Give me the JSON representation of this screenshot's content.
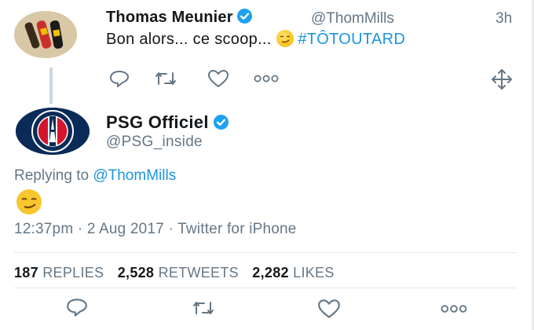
{
  "reply_tweet": {
    "author_name": "Thomas Meunier",
    "handle": "@ThomMills",
    "time": "3h",
    "text": "Bon alors... ce scoop...",
    "hashtag": "#TÔTOUTARD",
    "icons": [
      "reply-icon",
      "retweet-icon",
      "like-icon",
      "more-icon",
      "expand-icon"
    ]
  },
  "main_tweet": {
    "author_name": "PSG Officiel",
    "handle": "@PSG_inside",
    "replying_prefix": "Replying to",
    "replying_handle": "@ThomMills",
    "timestamp": "12:37pm · 2 Aug 2017 · Twitter for iPhone",
    "stats": {
      "replies_count": "187",
      "replies_label": "REPLIES",
      "retweets_count": "2,528",
      "retweets_label": "RETWEETS",
      "likes_count": "2,282",
      "likes_label": "LIKES"
    },
    "icons": [
      "reply-icon",
      "retweet-icon",
      "like-icon",
      "more-icon"
    ]
  },
  "colors": {
    "accent": "#1b95e0",
    "muted": "#657786",
    "verified": "#1da1f2",
    "divider": "#e1e8ed"
  }
}
